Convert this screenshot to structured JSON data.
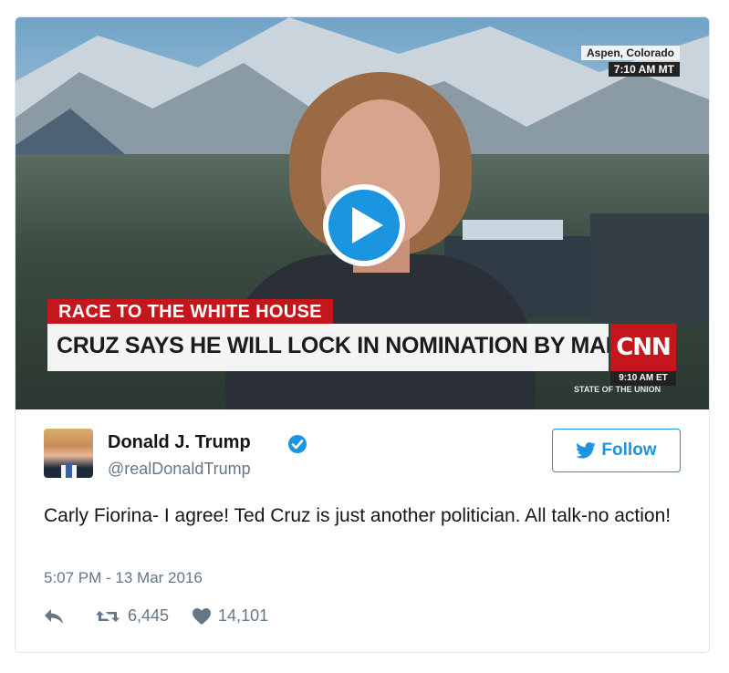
{
  "video": {
    "location": "Aspen, Colorado",
    "local_time": "7:10 AM MT",
    "chyron_header": "RACE TO THE WHITE HOUSE",
    "chyron_headline": "CRUZ SAYS HE WILL LOCK IN NOMINATION BY MARCH",
    "network_logo": "CNN",
    "network_time": "9:10 AM ET",
    "program": "STATE OF THE UNION",
    "play_icon": "play-icon"
  },
  "author": {
    "name": "Donald J. Trump",
    "handle": "@realDonaldTrump",
    "verified_icon": "verified-badge-icon"
  },
  "follow_button": {
    "label": "Follow",
    "icon": "twitter-bird-icon",
    "color": "#1b95e0"
  },
  "tweet": {
    "text": "Carly Fiorina- I agree! Ted Cruz is just another politician. All talk-no action!",
    "timestamp": "5:07 PM - 13 Mar 2016"
  },
  "actions": {
    "reply_icon": "reply-icon",
    "retweet_icon": "retweet-icon",
    "retweet_count": "6,445",
    "like_icon": "heart-icon",
    "like_count": "14,101"
  },
  "colors": {
    "accent": "#1b95e0",
    "cnn_red": "#c4161c",
    "secondary_text": "#657786",
    "border": "#e1e8ed"
  }
}
